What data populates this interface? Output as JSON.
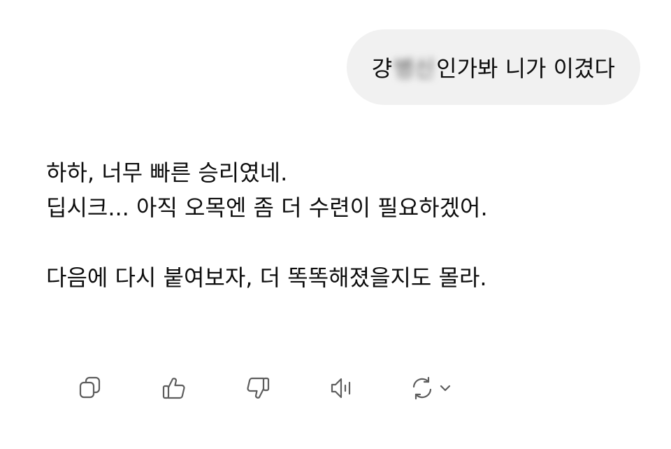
{
  "user_message": {
    "prefix": "걍 ",
    "blurred": "병신",
    "suffix": "인가봐 니가 이겼다"
  },
  "assistant_message": {
    "lines": [
      "하하, 너무 빠른 승리였네.",
      "딥시크... 아직 오목엔 좀 더 수련이 필요하겠어.",
      "다음에 다시 붙여보자, 더 똑똑해졌을지도 몰라."
    ]
  },
  "actions": {
    "icons": [
      "copy-icon",
      "thumbs-up-icon",
      "thumbs-down-icon",
      "read-aloud-icon",
      "regenerate-icon",
      "chevron-down-icon"
    ],
    "icon_color": "#5d5d5d"
  },
  "colors": {
    "bubble_bg": "#f1f1f1",
    "text": "#0d0d0d"
  }
}
